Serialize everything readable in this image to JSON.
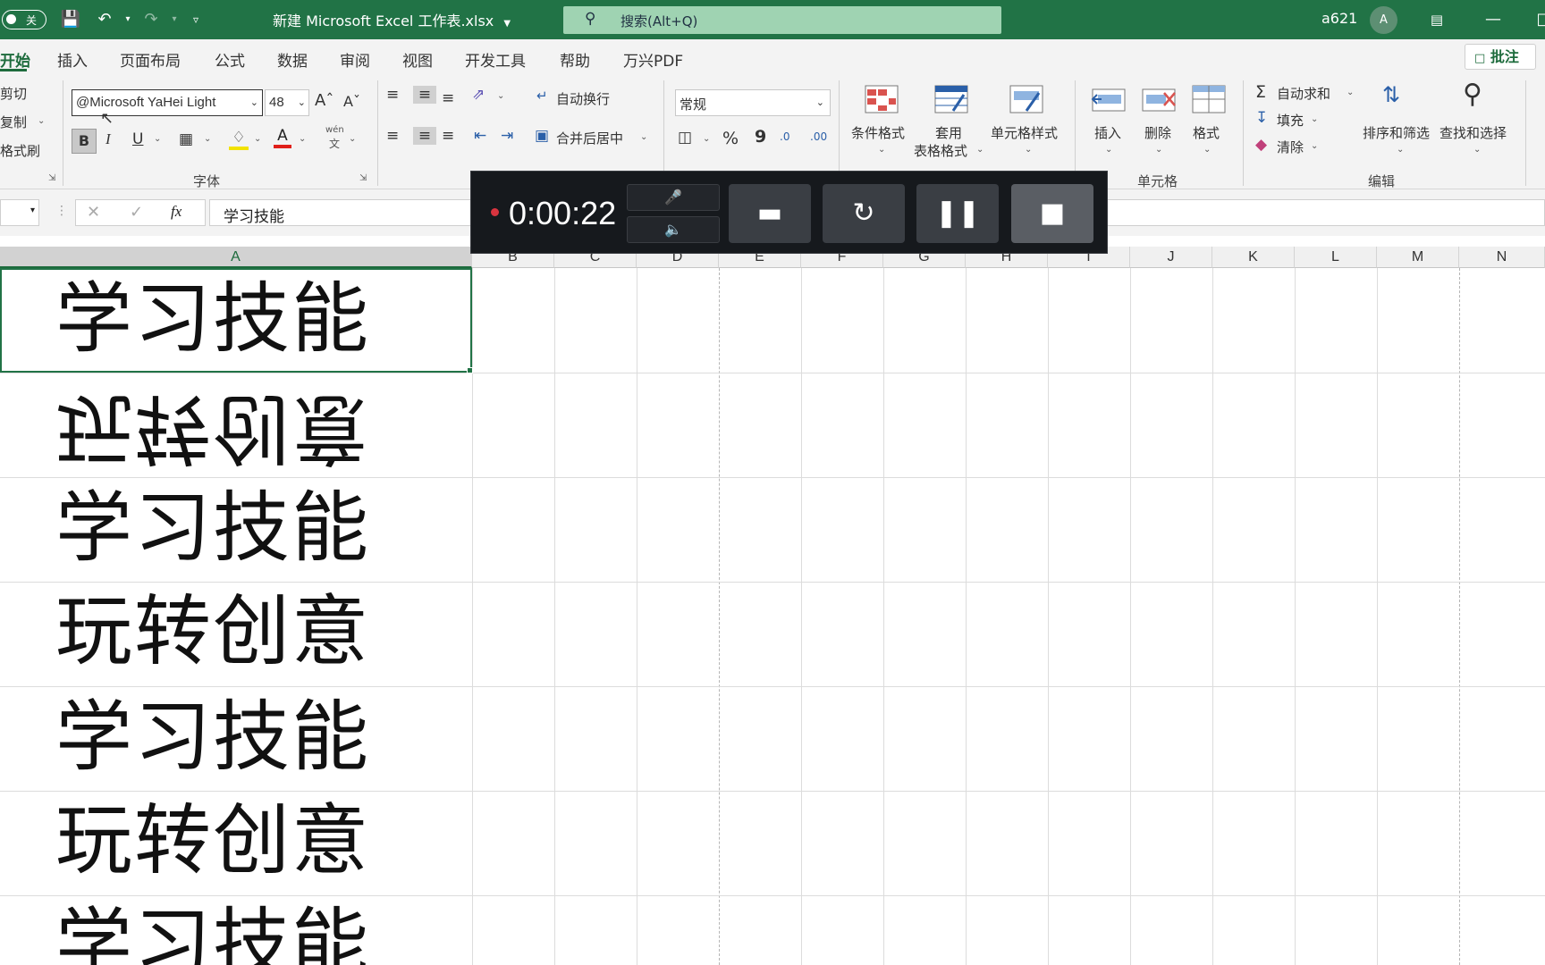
{
  "titlebar": {
    "autosave_label": "关",
    "doc_title": "新建 Microsoft Excel 工作表.xlsx",
    "search_placeholder": "搜索(Alt+Q)",
    "user_name": "a621",
    "avatar_initial": "A"
  },
  "tabs": [
    "开始",
    "插入",
    "页面布局",
    "公式",
    "数据",
    "审阅",
    "视图",
    "开发工具",
    "帮助",
    "万兴PDF"
  ],
  "comment_button": "批注",
  "clipboard": {
    "cut": "剪切",
    "copy": "复制",
    "format_painter": "格式刷"
  },
  "font": {
    "name": "@Microsoft YaHei Light",
    "size": "48",
    "group_label": "字体",
    "bold": "B",
    "italic": "I",
    "underline": "U",
    "phonetic_top": "wén",
    "phonetic_bottom": "文"
  },
  "alignment": {
    "wrap_text": "自动换行",
    "merge_center": "合并后居中"
  },
  "number": {
    "format": "常规",
    "percent": "%",
    "comma": "9",
    "inc_decimal": ".0",
    "dec_decimal": ".00"
  },
  "styles": {
    "conditional": "条件格式",
    "table_format_1": "套用",
    "table_format_2": "表格格式",
    "cell_styles": "单元格样式"
  },
  "cells": {
    "insert": "插入",
    "delete": "删除",
    "format": "格式",
    "group_label": "单元格"
  },
  "editing": {
    "autosum": "自动求和",
    "fill": "填充",
    "clear": "清除",
    "sort_filter": "排序和筛选",
    "find_select": "查找和选择",
    "group_label": "编辑"
  },
  "formula_bar": {
    "fx": "fx",
    "content": "学习技能"
  },
  "columns": [
    "A",
    "B",
    "C",
    "D",
    "E",
    "F",
    "G",
    "H",
    "I",
    "J",
    "K",
    "L",
    "M",
    "N"
  ],
  "cells_data": [
    {
      "text": "学习技能",
      "flipped": false
    },
    {
      "text": "玩转创意",
      "flipped": true
    },
    {
      "text": "学习技能",
      "flipped": false
    },
    {
      "text": "玩转创意",
      "flipped": false
    },
    {
      "text": "学习技能",
      "flipped": false
    },
    {
      "text": "玩转创意",
      "flipped": false
    },
    {
      "text": "学习技能",
      "flipped": false
    }
  ],
  "recorder": {
    "time": "0:00:22"
  },
  "colors": {
    "excel_green": "#217346",
    "recorder_bg": "#16191d",
    "record_dot": "#d8343f"
  }
}
